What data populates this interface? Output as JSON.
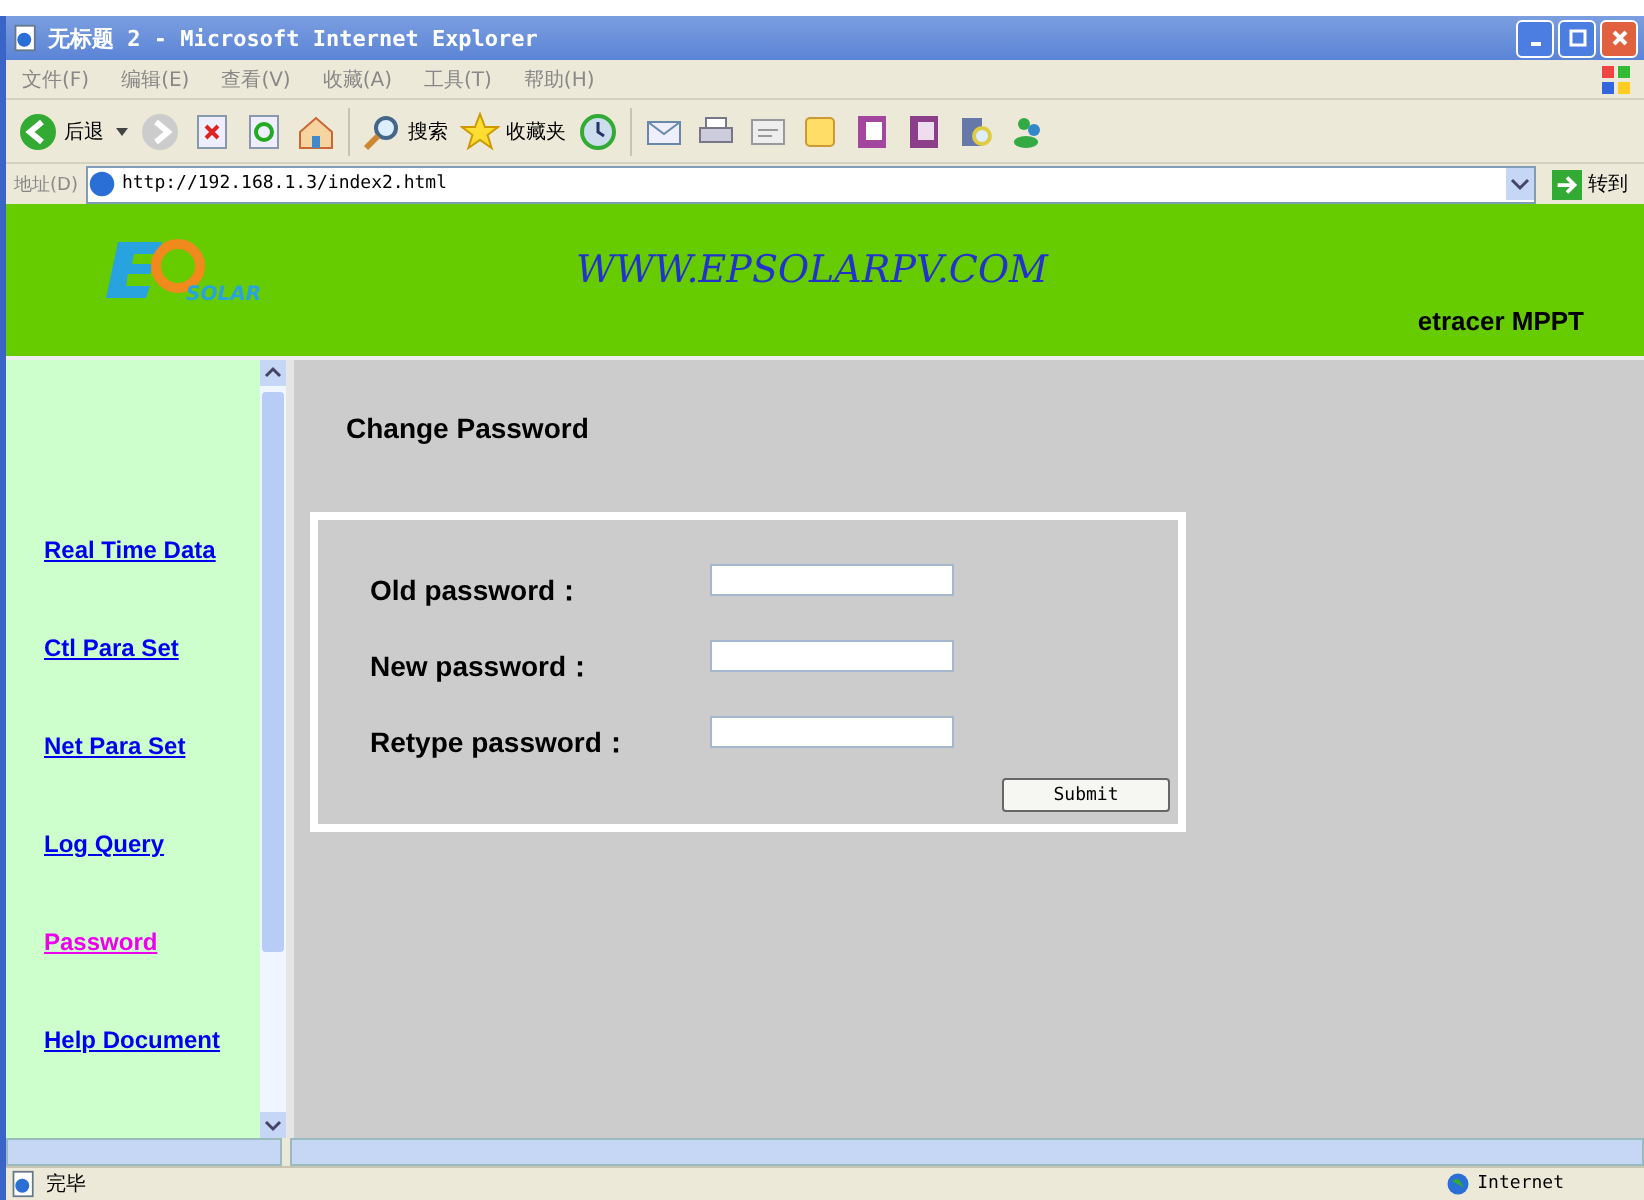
{
  "window": {
    "title": "无标题 2 - Microsoft Internet Explorer"
  },
  "menu": [
    "文件(F)",
    "编辑(E)",
    "查看(V)",
    "收藏(A)",
    "工具(T)",
    "帮助(H)"
  ],
  "toolbar": {
    "back": "后退",
    "search": "搜索",
    "favorites": "收藏夹"
  },
  "address": {
    "label": "地址(D)",
    "value": "http://192.168.1.3/index2.html",
    "go": "转到"
  },
  "header": {
    "logo_text": "SOLAR",
    "site": "WWW.EPSOLARPV.COM",
    "product": "etracer MPPT"
  },
  "sidebar": {
    "items": [
      {
        "label": "Real Time Data",
        "selected": false
      },
      {
        "label": "Ctl Para Set",
        "selected": false
      },
      {
        "label": "Net Para Set",
        "selected": false
      },
      {
        "label": "Log Query",
        "selected": false
      },
      {
        "label": "Password",
        "selected": true
      },
      {
        "label": "Help Document",
        "selected": false
      }
    ]
  },
  "form": {
    "title": "Change Password",
    "fields": [
      {
        "label": "Old password："
      },
      {
        "label": "New password："
      },
      {
        "label": "Retype password："
      }
    ],
    "submit": "Submit"
  },
  "status_bar": {
    "text": "完毕",
    "zone": "Internet"
  }
}
